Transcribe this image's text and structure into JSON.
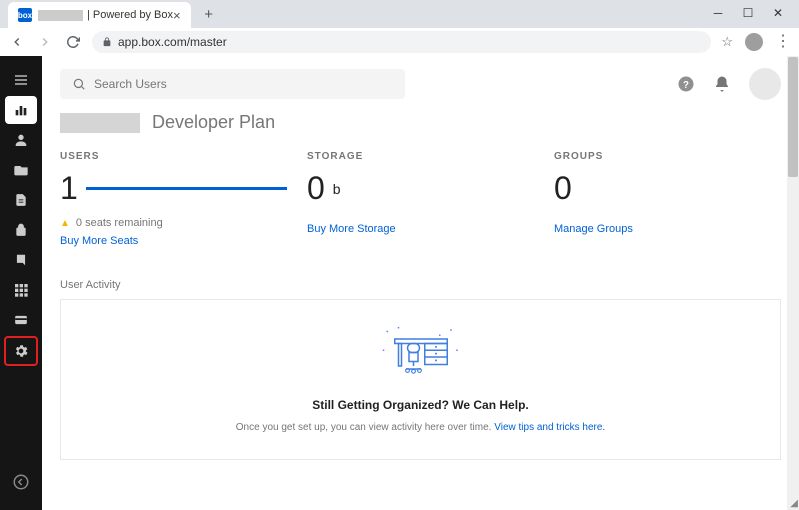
{
  "browser": {
    "tab_title_suffix": " | Powered by Box",
    "url": "app.box.com/master"
  },
  "search": {
    "placeholder": "Search Users"
  },
  "plan_name": "Developer Plan",
  "stats": {
    "users": {
      "label": "USERS",
      "value": "1",
      "warning": "0 seats remaining",
      "link": "Buy More Seats"
    },
    "storage": {
      "label": "STORAGE",
      "value": "0",
      "unit": "b",
      "link": "Buy More Storage"
    },
    "groups": {
      "label": "GROUPS",
      "value": "0",
      "link": "Manage Groups"
    }
  },
  "activity": {
    "section_label": "User Activity",
    "title": "Still Getting Organized? We Can Help.",
    "desc_pre": "Once you get set up, you can view activity here over time. ",
    "desc_link": "View tips and tricks here."
  }
}
